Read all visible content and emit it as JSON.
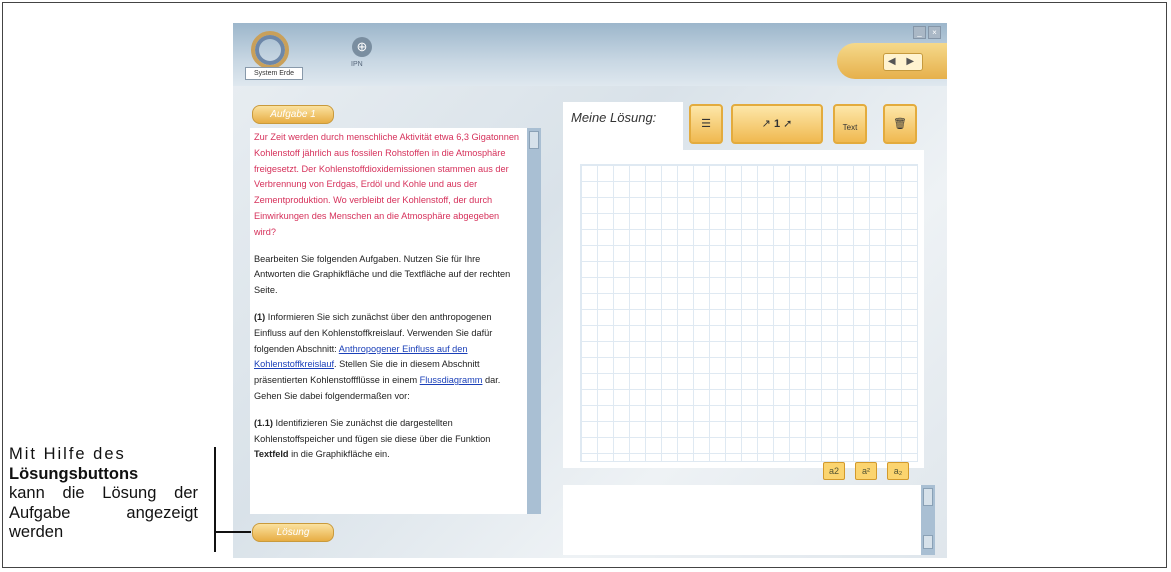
{
  "header": {
    "logo_label": "System Erde",
    "ipn_label": "IPN",
    "nav_arrows": "◀ ▶"
  },
  "task": {
    "tab_label": "Aufgabe 1",
    "intro": "Zur Zeit werden durch menschliche Aktivität etwa 6,3 Gigatonnen Kohlenstoff jährlich aus fossilen Rohstoffen in die Atmosphäre freigesetzt. Der Kohlenstoffdioxidemissionen stammen aus der Verbrennung von Erdgas, Erdöl und Kohle und aus der Zementproduktion. Wo verbleibt der Kohlenstoff, der durch Einwirkungen des Menschen an die Atmosphäre abgegeben wird?",
    "instructions": "Bearbeiten Sie folgenden Aufgaben. Nutzen Sie für Ihre Antworten die Graphikfläche und die Textfläche auf der rechten Seite.",
    "step1_label": "(1)",
    "step1_text_a": " Informieren Sie sich zunächst über den anthropogenen Einfluss auf den Kohlenstoffkreislauf. Verwenden Sie dafür folgenden Abschnitt: ",
    "step1_link1": "Anthropogener Einfluss auf den Kohlenstoffkreislauf",
    "step1_text_b": ". Stellen Sie die in diesem Abschnitt präsentierten Kohlenstoffflüsse in einem ",
    "step1_link2": "Flussdiagramm",
    "step1_text_c": " dar. Gehen Sie dabei folgendermaßen vor:",
    "step11_label": "(1.1)",
    "step11_text_a": " Identifizieren Sie zunächst die dargestellten Kohlenstoffspeicher und fügen sie diese über die Funktion ",
    "step11_bold": "Textfeld",
    "step11_text_b": " in die Graphikfläche ein.",
    "solution_button": "Lösung"
  },
  "solution": {
    "title": "Meine Lösung:",
    "tools": {
      "text_tool_label": "Text",
      "arrow_count": "1"
    },
    "format_buttons": [
      "a2",
      "a²",
      "a₂"
    ]
  },
  "annotation": {
    "line1": "Mit Hilfe des",
    "line2": "Lösungsbuttons",
    "line3": "kann die Lösung der Aufgabe angezeigt werden"
  }
}
